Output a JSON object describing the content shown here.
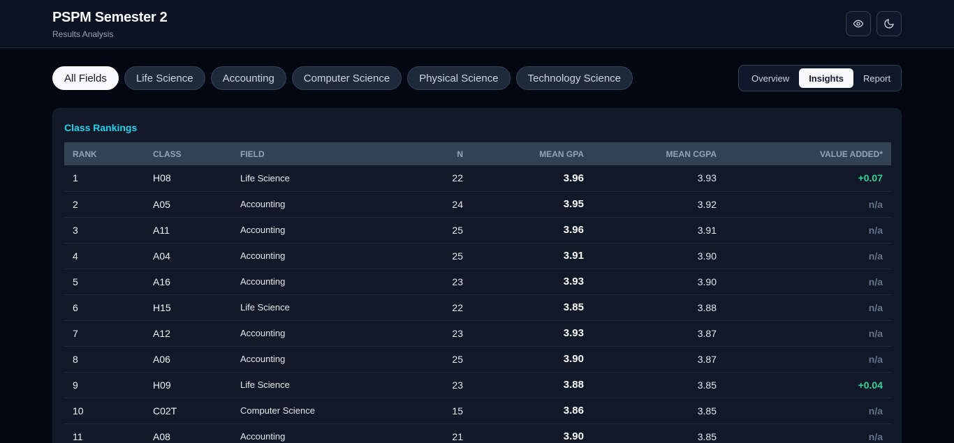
{
  "header": {
    "title": "PSPM Semester 2",
    "subtitle": "Results Analysis",
    "eye_icon": "eye-icon",
    "moon_icon": "moon-icon"
  },
  "filters": [
    "All Fields",
    "Life Science",
    "Accounting",
    "Computer Science",
    "Physical Science",
    "Technology Science"
  ],
  "active_filter": "All Fields",
  "views": [
    "Overview",
    "Insights",
    "Report"
  ],
  "active_view": "Insights",
  "rankings": {
    "title": "Class Rankings",
    "columns": [
      "RANK",
      "CLASS",
      "FIELD",
      "N",
      "MEAN GPA",
      "MEAN CGPA",
      "VALUE ADDED*"
    ],
    "rows": [
      {
        "rank": "1",
        "class": "H08",
        "field": "Life Science",
        "n": "22",
        "gpa": "3.96",
        "cgpa": "3.93",
        "va": "+0.07"
      },
      {
        "rank": "2",
        "class": "A05",
        "field": "Accounting",
        "n": "24",
        "gpa": "3.95",
        "cgpa": "3.92",
        "va": "n/a"
      },
      {
        "rank": "3",
        "class": "A11",
        "field": "Accounting",
        "n": "25",
        "gpa": "3.96",
        "cgpa": "3.91",
        "va": "n/a"
      },
      {
        "rank": "4",
        "class": "A04",
        "field": "Accounting",
        "n": "25",
        "gpa": "3.91",
        "cgpa": "3.90",
        "va": "n/a"
      },
      {
        "rank": "5",
        "class": "A16",
        "field": "Accounting",
        "n": "23",
        "gpa": "3.93",
        "cgpa": "3.90",
        "va": "n/a"
      },
      {
        "rank": "6",
        "class": "H15",
        "field": "Life Science",
        "n": "22",
        "gpa": "3.85",
        "cgpa": "3.88",
        "va": "n/a"
      },
      {
        "rank": "7",
        "class": "A12",
        "field": "Accounting",
        "n": "23",
        "gpa": "3.93",
        "cgpa": "3.87",
        "va": "n/a"
      },
      {
        "rank": "8",
        "class": "A06",
        "field": "Accounting",
        "n": "25",
        "gpa": "3.90",
        "cgpa": "3.87",
        "va": "n/a"
      },
      {
        "rank": "9",
        "class": "H09",
        "field": "Life Science",
        "n": "23",
        "gpa": "3.88",
        "cgpa": "3.85",
        "va": "+0.04"
      },
      {
        "rank": "10",
        "class": "C02T",
        "field": "Computer Science",
        "n": "15",
        "gpa": "3.86",
        "cgpa": "3.85",
        "va": "n/a"
      },
      {
        "rank": "11",
        "class": "A08",
        "field": "Accounting",
        "n": "21",
        "gpa": "3.90",
        "cgpa": "3.85",
        "va": "n/a"
      }
    ]
  },
  "colors": {
    "accent": "#22d3ee",
    "positive": "#34d399",
    "muted": "#64748b"
  }
}
